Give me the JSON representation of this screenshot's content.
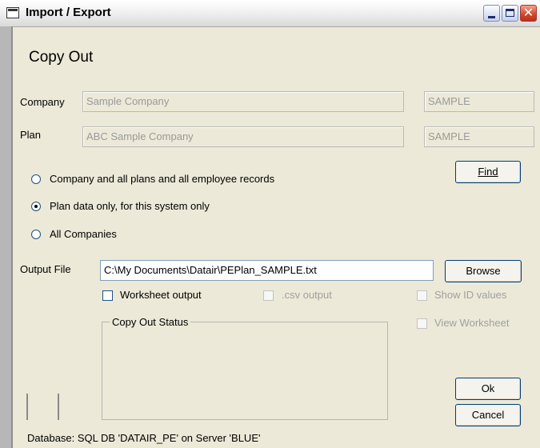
{
  "window": {
    "title": "Import / Export"
  },
  "heading": "Copy Out",
  "company": {
    "label": "Company",
    "name": "Sample Company",
    "code": "SAMPLE"
  },
  "plan": {
    "label": "Plan",
    "name": "ABC Sample Company",
    "code": "SAMPLE"
  },
  "buttons": {
    "find": "Find",
    "browse": "Browse",
    "ok": "Ok",
    "cancel": "Cancel"
  },
  "radios": [
    {
      "label": "Company and all plans and all employee records",
      "selected": false
    },
    {
      "label": "Plan data only, for this system only",
      "selected": true
    },
    {
      "label": "All Companies",
      "selected": false
    }
  ],
  "output_file": {
    "label": "Output File",
    "value": "C:\\My Documents\\Datair\\PEPlan_SAMPLE.txt"
  },
  "checkboxes": {
    "worksheet_output": "Worksheet output",
    "csv_output": ".csv output",
    "show_id_values": "Show ID values",
    "view_worksheet": "View Worksheet"
  },
  "status_group": {
    "label": "Copy Out Status"
  },
  "footer": {
    "database": "Database: SQL DB  'DATAIR_PE' on Server 'BLUE'"
  }
}
